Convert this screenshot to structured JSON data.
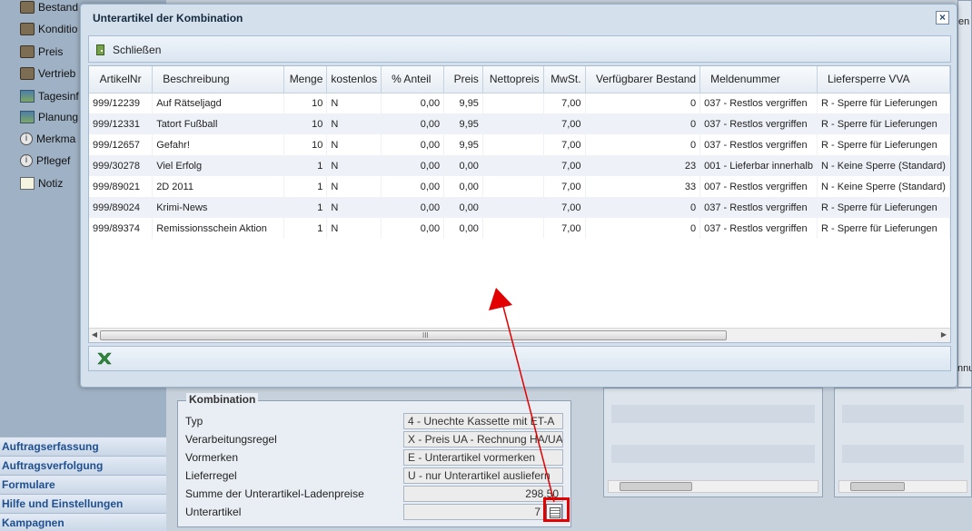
{
  "sidebar": {
    "items": [
      {
        "label": "Bestand",
        "icon": "box-icon"
      },
      {
        "label": "Konditio",
        "icon": "box-icon"
      },
      {
        "label": "Preis",
        "icon": "box-icon"
      },
      {
        "label": "Vertrieb",
        "icon": "box-icon"
      },
      {
        "label": "Tagesinf",
        "icon": "image-icon"
      },
      {
        "label": "Planung",
        "icon": "image-icon"
      },
      {
        "label": "Merkma",
        "icon": "info-icon"
      },
      {
        "label": "Pflegef",
        "icon": "info-icon"
      },
      {
        "label": "Notiz",
        "icon": "note-icon"
      }
    ],
    "accordion": [
      "Auftragserfassung",
      "Auftragsverfolgung",
      "Formulare",
      "Hilfe und Einstellungen",
      "Kampagnen"
    ]
  },
  "background_right": {
    "partial_1": "en",
    "partial_2": "nnu"
  },
  "kombination": {
    "legend": "Kombination",
    "rows": [
      {
        "label": "Typ",
        "value": "4 - Unechte Kassette mit ET-A"
      },
      {
        "label": "Verarbeitungsregel",
        "value": "X - Preis UA - Rechnung HA/UA"
      },
      {
        "label": "Vormerken",
        "value": "E - Unterartikel vormerken"
      },
      {
        "label": "Lieferregel",
        "value": "U - nur Unterartikel ausliefern"
      },
      {
        "label": "Summe der Unterartikel-Ladenpreise",
        "value": "298,50"
      },
      {
        "label": "Unterartikel",
        "value": "7"
      }
    ]
  },
  "dialog": {
    "title": "Unterartikel der Kombination",
    "close_symbol": "×",
    "toolbar": {
      "close_label": "Schließen"
    },
    "columns": [
      "ArtikelNr",
      "Beschreibung",
      "Menge",
      "kostenlos",
      "% Anteil",
      "Preis",
      "Nettopreis",
      "MwSt.",
      "Verfügbarer Bestand",
      "Meldenummer",
      "Liefersperre VVA"
    ],
    "rows": [
      [
        "999/12239",
        "Auf Rätseljagd",
        "10",
        "N",
        "0,00",
        "9,95",
        "",
        "7,00",
        "0",
        "037 - Restlos vergriffen",
        "R - Sperre für Lieferungen"
      ],
      [
        "999/12331",
        "Tatort Fußball",
        "10",
        "N",
        "0,00",
        "9,95",
        "",
        "7,00",
        "0",
        "037 - Restlos vergriffen",
        "R - Sperre für Lieferungen"
      ],
      [
        "999/12657",
        "Gefahr!",
        "10",
        "N",
        "0,00",
        "9,95",
        "",
        "7,00",
        "0",
        "037 - Restlos vergriffen",
        "R - Sperre für Lieferungen"
      ],
      [
        "999/30278",
        "Viel Erfolg",
        "1",
        "N",
        "0,00",
        "0,00",
        "",
        "7,00",
        "23",
        "001 - Lieferbar innerhalb",
        "N - Keine Sperre (Standard)"
      ],
      [
        "999/89021",
        "2D 2011",
        "1",
        "N",
        "0,00",
        "0,00",
        "",
        "7,00",
        "33",
        "007 - Restlos vergriffen",
        "N - Keine Sperre (Standard)"
      ],
      [
        "999/89024",
        "Krimi-News",
        "1",
        "N",
        "0,00",
        "0,00",
        "",
        "7,00",
        "0",
        "037 - Restlos vergriffen",
        "R - Sperre für Lieferungen"
      ],
      [
        "999/89374",
        "Remissionsschein Aktion",
        "1",
        "N",
        "0,00",
        "0,00",
        "",
        "7,00",
        "0",
        "037 - Restlos vergriffen",
        "R - Sperre für Lieferungen"
      ]
    ],
    "scroll_left": "◀",
    "scroll_right": "▶",
    "scroll_grip": "III"
  },
  "annotation": {
    "color": "#e20000"
  }
}
